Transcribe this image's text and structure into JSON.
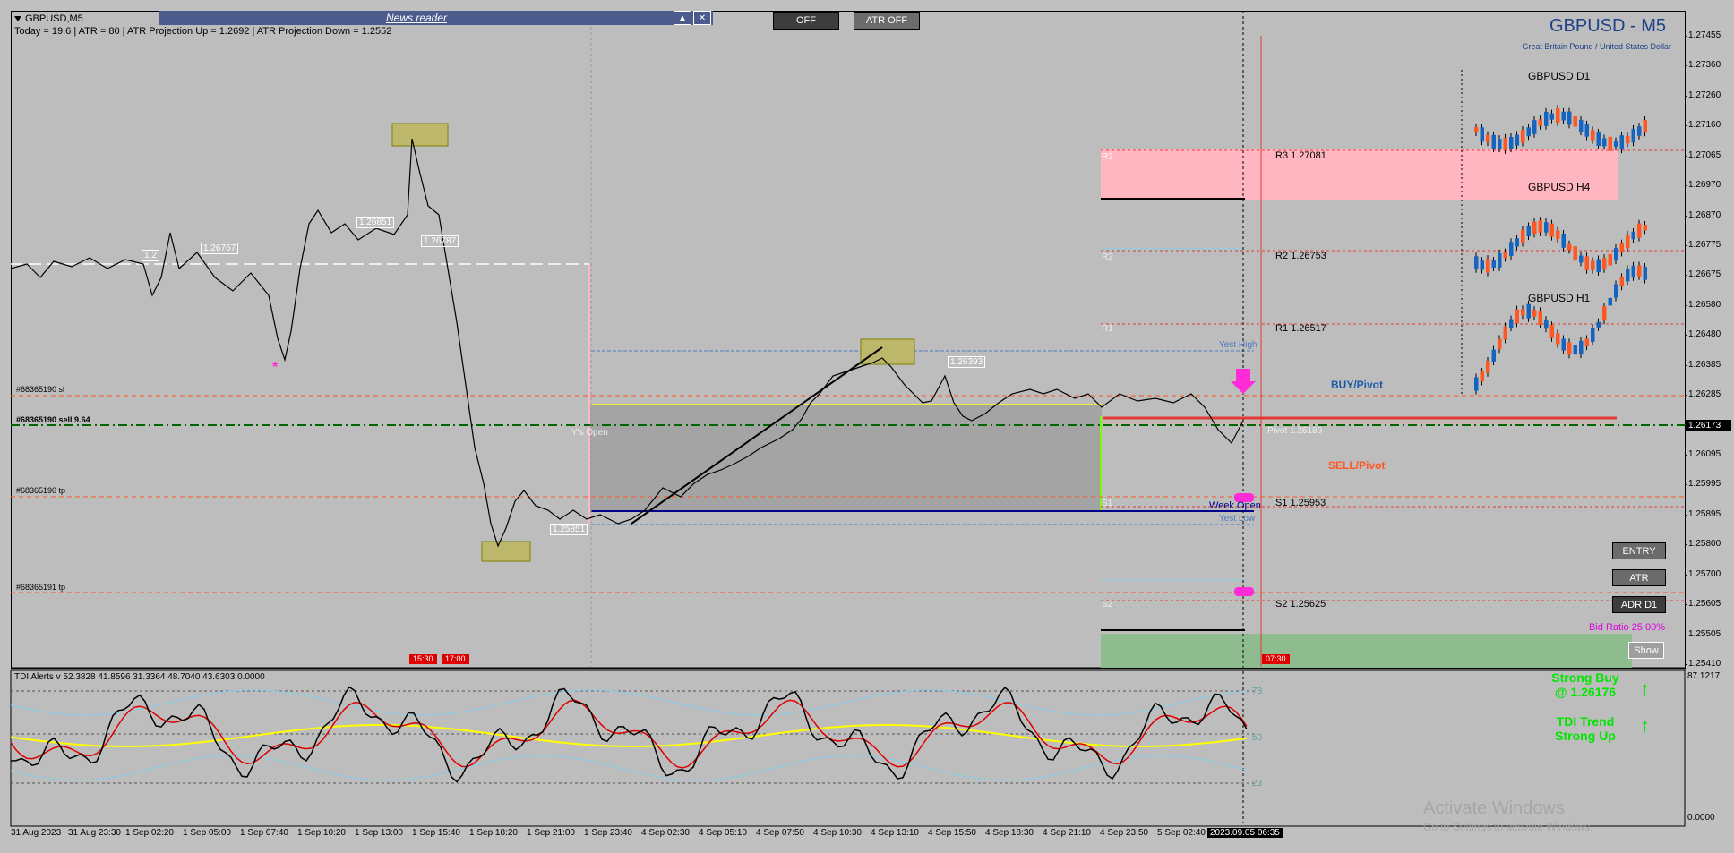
{
  "window": {
    "symbol": "GBPUSD,M5",
    "info_line": "Today = 19.6  |  ATR = 80  |  ATR Projection Up = 1.2692  |  ATR Projection Down = 1.2552"
  },
  "news_reader": {
    "title": "News reader",
    "minimize_icon": "triangle-up-icon",
    "close_icon": "close-icon"
  },
  "toolbar": {
    "off_label": "OFF",
    "atr_off_label": "ATR OFF"
  },
  "header": {
    "title": "GBPUSD - M5",
    "subtitle": "Great Britain Pound / United States Dollar"
  },
  "mini_charts": [
    "GBPUSD D1",
    "GBPUSD H4",
    "GBPUSD H1"
  ],
  "levels": {
    "r3": "R3 1.27081",
    "r2": "R2 1.26753",
    "r1": "R1 1.26517",
    "s1": "S1 1.25953",
    "s2": "S2 1.25625",
    "r3_short": "R3",
    "r2_short": "R2",
    "r1_short": "R1",
    "s1_short": "S1",
    "s2_short": "S2",
    "yest_high": "Yest High",
    "yest_low": "Yest Low",
    "week_open": "Week Open",
    "ys_open": "Y's Open",
    "pivot": "Pivot 1.26189",
    "buy_pivot": "BUY/Pivot",
    "sell_pivot": "SELL/Pivot"
  },
  "orders": {
    "sl": "#68365190 sl",
    "sell": "#68365190 sell 9.64",
    "tp1": "#68365190 tp",
    "tp2": "#68365191 tp"
  },
  "chart_labels": {
    "l1": "1.26767",
    "l2": "1.26851",
    "l3": "1.26787",
    "l4": "1.26393",
    "l5": "1.25851",
    "l6": "1.2"
  },
  "right_buttons": {
    "entry": "ENTRY",
    "atr": "ATR",
    "adr": "ADR D1",
    "show": "Show"
  },
  "bid_ratio": "Bid Ratio 25.00%",
  "session_tags": {
    "t1": "15:30",
    "t2": "17:00",
    "t3": "07:30"
  },
  "indicator": {
    "title": "TDI Alerts v 52.3828 41.8596 31.3364 48.7040 43.6303 0.0000",
    "level_78": "78",
    "level_50": "50",
    "level_23": "23",
    "scale_top": "87.1217",
    "scale_bottom": "0.0000",
    "signal1_line1": "Strong Buy",
    "signal1_line2": "@ 1.26176",
    "signal2_line1": "TDI Trend",
    "signal2_line2": "Strong Up"
  },
  "price_scale": [
    "1.27455",
    "1.27360",
    "1.27260",
    "1.27160",
    "1.27065",
    "1.26970",
    "1.26870",
    "1.26775",
    "1.26675",
    "1.26580",
    "1.26480",
    "1.26385",
    "1.26285",
    "1.26190",
    "1.26095",
    "1.25995",
    "1.25895",
    "1.25800",
    "1.25700",
    "1.25605",
    "1.25505",
    "1.25410"
  ],
  "current_price": "1.26173",
  "time_axis": [
    "31 Aug 2023",
    "31 Aug 23:30",
    "1 Sep 02:20",
    "1 Sep 05:00",
    "1 Sep 07:40",
    "1 Sep 10:20",
    "1 Sep 13:00",
    "1 Sep 15:40",
    "1 Sep 18:20",
    "1 Sep 21:00",
    "1 Sep 23:40",
    "4 Sep 02:30",
    "4 Sep 05:10",
    "4 Sep 07:50",
    "4 Sep 10:30",
    "4 Sep 13:10",
    "4 Sep 15:50",
    "4 Sep 18:30",
    "4 Sep 21:10",
    "4 Sep 23:50",
    "5 Sep 02:40"
  ],
  "time_now": "2023.09.05 06:35",
  "watermark": {
    "line1": "Activate Windows",
    "line2": "Go to Settings to activate Windows."
  },
  "colors": {
    "bullish": "#1565c0",
    "bearish": "#ff5722",
    "r3_zone": "#ffb6c1",
    "s_zone": "#8fbc8f",
    "tdi_signal": "#00e600"
  }
}
